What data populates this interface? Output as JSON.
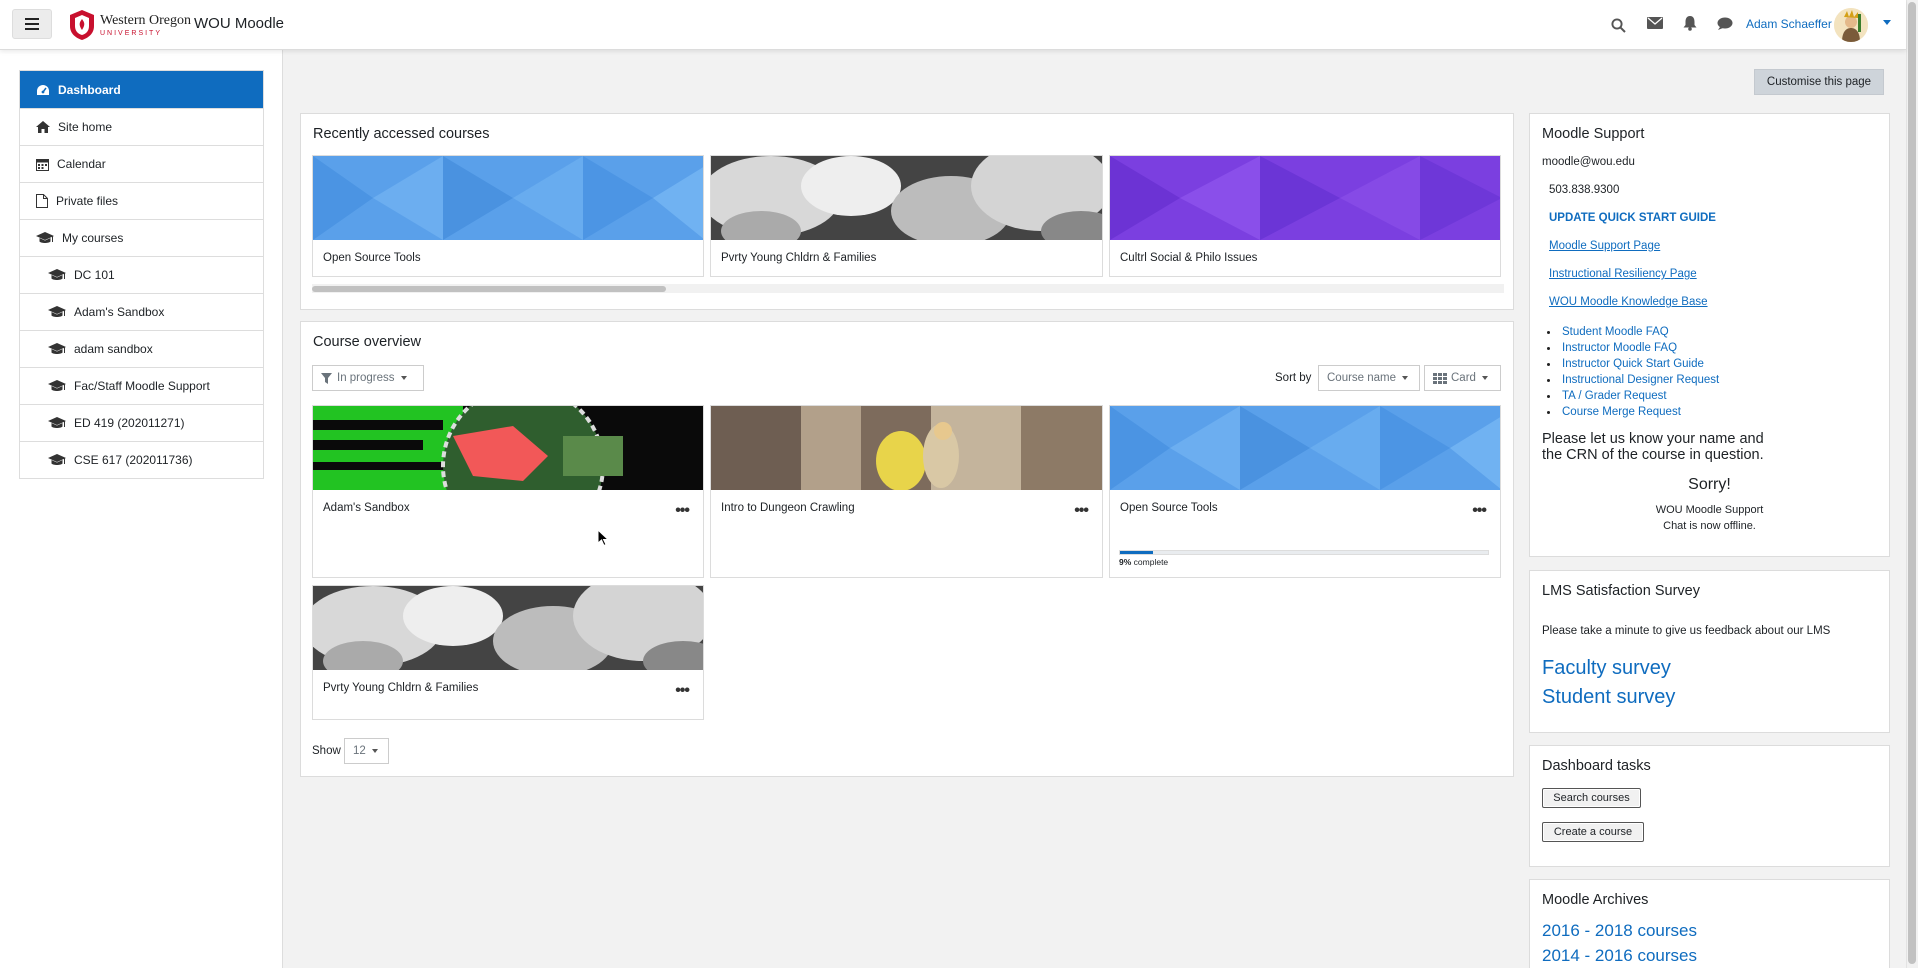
{
  "navbar": {
    "menu_label": "Toggle navigation",
    "logo_line1": "Western Oregon",
    "logo_line2": "UNIVERSITY",
    "brand": "WOU Moodle",
    "user_name": "Adam Schaeffer"
  },
  "drawer": {
    "items": [
      {
        "label": "Dashboard",
        "icon": "dashboard-icon",
        "active": true
      },
      {
        "label": "Site home",
        "icon": "home-icon"
      },
      {
        "label": "Calendar",
        "icon": "calendar-icon"
      },
      {
        "label": "Private files",
        "icon": "file-icon"
      },
      {
        "label": "My courses",
        "icon": "graduation-cap-icon"
      },
      {
        "label": "DC 101",
        "icon": "graduation-cap-icon",
        "sub": true
      },
      {
        "label": "Adam's Sandbox",
        "icon": "graduation-cap-icon",
        "sub": true
      },
      {
        "label": "adam sandbox",
        "icon": "graduation-cap-icon",
        "sub": true
      },
      {
        "label": "Fac/Staff Moodle Support",
        "icon": "graduation-cap-icon",
        "sub": true
      },
      {
        "label": "ED 419 (202011271)",
        "icon": "graduation-cap-icon",
        "sub": true
      },
      {
        "label": "CSE 617 (202011736)",
        "icon": "graduation-cap-icon",
        "sub": true
      }
    ]
  },
  "main": {
    "customise_label": "Customise this page",
    "recent": {
      "title": "Recently accessed courses",
      "courses": [
        "Open Source Tools",
        "Pvrty Young Chldrn & Families",
        "Cultrl Social & Philo Issues"
      ]
    },
    "overview": {
      "title": "Course overview",
      "filter_label": "In progress",
      "sort_label": "Sort by",
      "sort_value": "Course name",
      "view_label": "Card",
      "courses": [
        {
          "name": "Adam's Sandbox"
        },
        {
          "name": "Intro to Dungeon Crawling"
        },
        {
          "name": "Open Source Tools",
          "progress_pct": "9%",
          "progress_suffix": "complete",
          "progress": 0.09
        },
        {
          "name": "Pvrty Young Chldrn & Families"
        }
      ],
      "show_label": "Show",
      "show_value": "12"
    }
  },
  "right": {
    "support": {
      "title": "Moodle Support",
      "email": "moodle@wou.edu",
      "phone": "503.838.9300",
      "quick_start": "UPDATE QUICK START GUIDE",
      "links": [
        "Moodle Support Page",
        "Instructional Resiliency Page",
        "WOU Moodle Knowledge Base"
      ],
      "faq": [
        "Student Moodle FAQ",
        "Instructor Moodle FAQ",
        "Instructor Quick Start Guide",
        "Instructional Designer Request",
        "TA / Grader Request",
        "Course Merge Request"
      ],
      "note_line1": "Please let us know your name and",
      "note_line2": "the CRN of the course in question.",
      "sorry": "Sorry!",
      "chat_line1": "WOU Moodle Support",
      "chat_line2": "Chat is now offline."
    },
    "survey": {
      "title": "LMS Satisfaction Survey",
      "text": "Please take a minute to give us feedback about our LMS",
      "faculty": "Faculty survey",
      "student": "Student survey"
    },
    "tasks": {
      "title": "Dashboard tasks",
      "search": "Search courses",
      "create": "Create a course"
    },
    "archives": {
      "title": "Moodle Archives",
      "links": [
        "2016 - 2018 courses",
        "2014 - 2016 courses"
      ]
    }
  },
  "colors": {
    "accent": "#0f6cbf",
    "brand_red": "#c8102e"
  }
}
